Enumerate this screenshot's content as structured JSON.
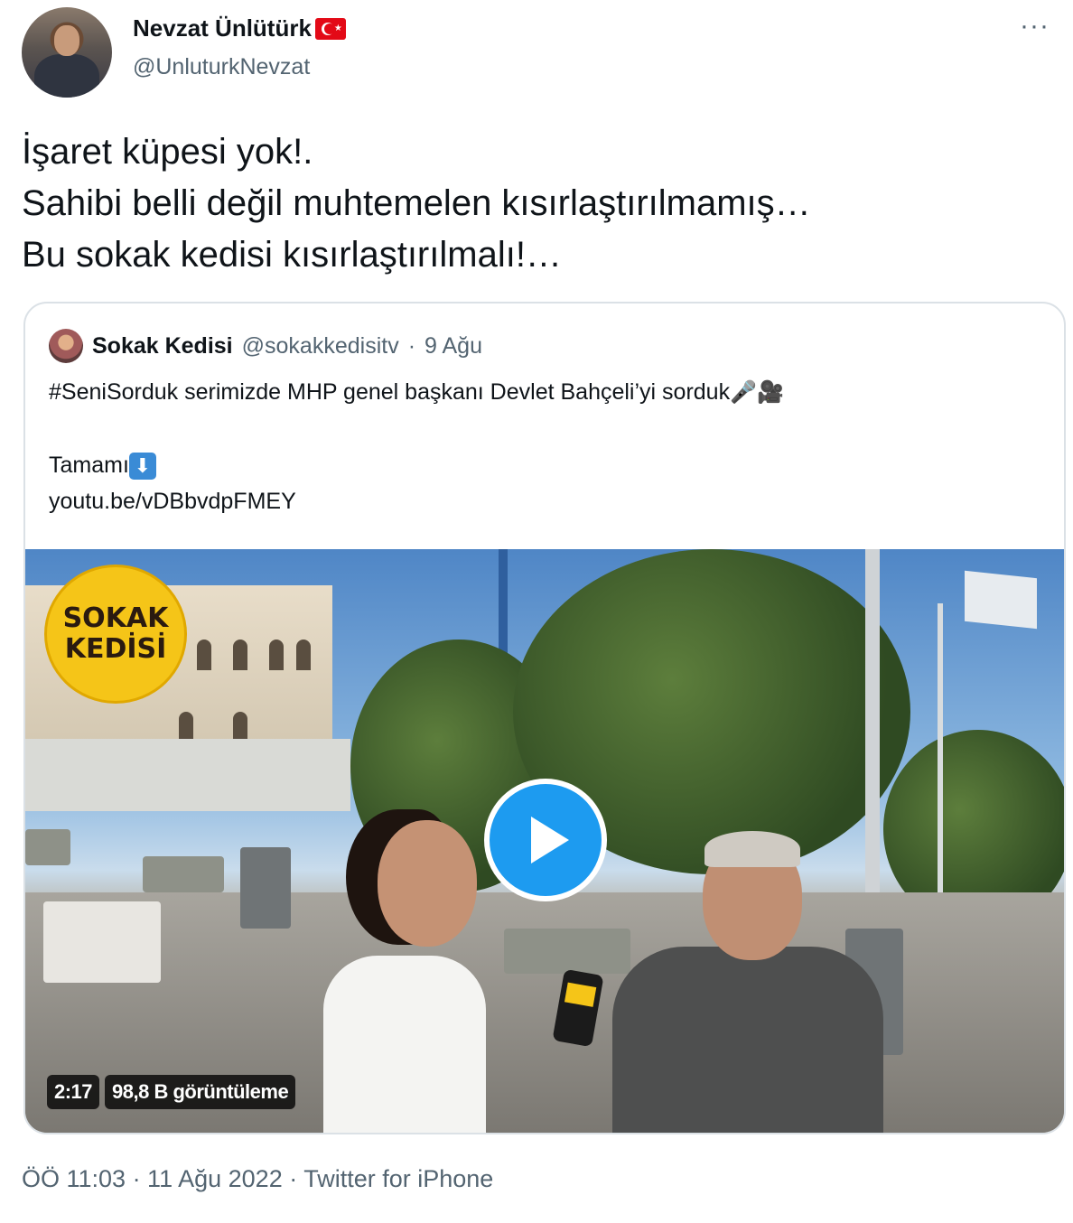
{
  "author": {
    "name": "Nevzat Ünlütürk",
    "handle": "@UnluturkNevzat",
    "flag": "turkey-flag-icon"
  },
  "more_label": "···",
  "tweet_lines": [
    "İşaret küpesi yok!.",
    "Sahibi belli değil muhtemelen kısırlaştırılmamış…",
    "Bu sokak kedisi kısırlaştırılmalı!…"
  ],
  "quote": {
    "name": "Sokak Kedisi",
    "handle": "@sokakkedisitv",
    "separator": "·",
    "time": "9 Ağu",
    "text": "#SeniSorduk serimizde MHP genel başkanı Devlet Bahçeli’yi sorduk",
    "emojis": "🎤🎥",
    "more_label": "Tamamı",
    "down_icon": "⬇",
    "link": "youtu.be/vDBbvdpFMEY"
  },
  "video": {
    "logo_line1": "SOKAK",
    "logo_line2": "KEDİSİ",
    "duration": "2:17",
    "views": "98,8 B görüntüleme"
  },
  "footer": {
    "text": "ÖÖ 11:03 · 11 Ağu 2022 · Twitter for iPhone"
  },
  "colors": {
    "accent": "#1d9bf0",
    "secondary_text": "#536471",
    "logo_yellow": "#f5c518"
  }
}
